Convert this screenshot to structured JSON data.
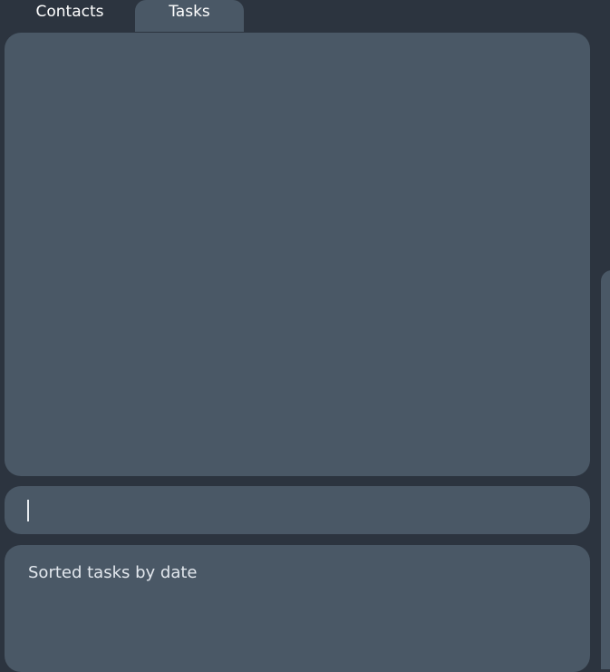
{
  "tabs": [
    {
      "label": "Contacts",
      "selected": false
    },
    {
      "label": "Tasks",
      "selected": true
    }
  ],
  "command_box": {
    "value": "",
    "placeholder": ""
  },
  "result_display": {
    "text": "Sorted tasks by date"
  },
  "colors": {
    "background": "#2c343f",
    "panel": "#4a5866",
    "text": "#ffffff",
    "result_text": "#e3e8ee"
  }
}
